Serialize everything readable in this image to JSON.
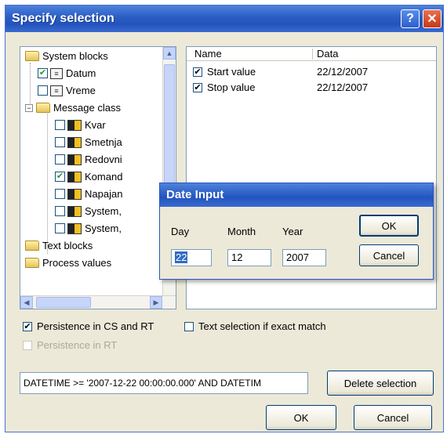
{
  "window": {
    "title": "Specify selection",
    "help_glyph": "?",
    "close_glyph": "✕"
  },
  "tree": {
    "nodes": [
      {
        "label": "System blocks",
        "checked": null,
        "icon": "folder-icon",
        "expander": null
      },
      {
        "label": "Datum",
        "checked": true,
        "icon": "document-icon"
      },
      {
        "label": "Vreme",
        "checked": false,
        "icon": "document-icon"
      },
      {
        "label": "Message class",
        "checked": null,
        "icon": "folder-icon",
        "expander": "−"
      },
      {
        "label": "Kvar",
        "checked": false,
        "icon": "message-icon"
      },
      {
        "label": "Smetnja",
        "checked": false,
        "icon": "message-icon"
      },
      {
        "label": "Redovni",
        "checked": false,
        "icon": "message-icon"
      },
      {
        "label": "Komand",
        "checked": true,
        "icon": "message-icon"
      },
      {
        "label": "Napajan",
        "checked": false,
        "icon": "message-icon"
      },
      {
        "label": "System,",
        "checked": false,
        "icon": "message-icon"
      },
      {
        "label": "System,",
        "checked": false,
        "icon": "message-icon"
      },
      {
        "label": "Text blocks",
        "checked": null,
        "icon": "folder-icon"
      },
      {
        "label": "Process values",
        "checked": null,
        "icon": "folder-icon"
      }
    ]
  },
  "list": {
    "columns": [
      "Name",
      "Data"
    ],
    "rows": [
      {
        "name": "Start value",
        "data": "22/12/2007",
        "checked": true
      },
      {
        "name": "Stop value",
        "data": "22/12/2007",
        "checked": true
      }
    ]
  },
  "options": {
    "persist_cs_rt": "Persistence in CS and RT",
    "persist_cs_rt_checked": true,
    "exact_match": "Text selection if exact match",
    "exact_match_checked": false,
    "persist_rt": "Persistence in RT",
    "persist_rt_checked": false
  },
  "query": {
    "text": "DATETIME >= '2007-12-22 00:00:00.000' AND DATETIM"
  },
  "buttons": {
    "delete_selection": "Delete selection",
    "ok": "OK",
    "cancel": "Cancel"
  },
  "date_input": {
    "title": "Date Input",
    "day_label": "Day",
    "month_label": "Month",
    "year_label": "Year",
    "day_value": "22",
    "month_value": "12",
    "year_value": "2007",
    "ok": "OK",
    "cancel": "Cancel"
  },
  "glyphs": {
    "check": "✔",
    "up": "▲",
    "left": "◀",
    "right": "▶"
  }
}
